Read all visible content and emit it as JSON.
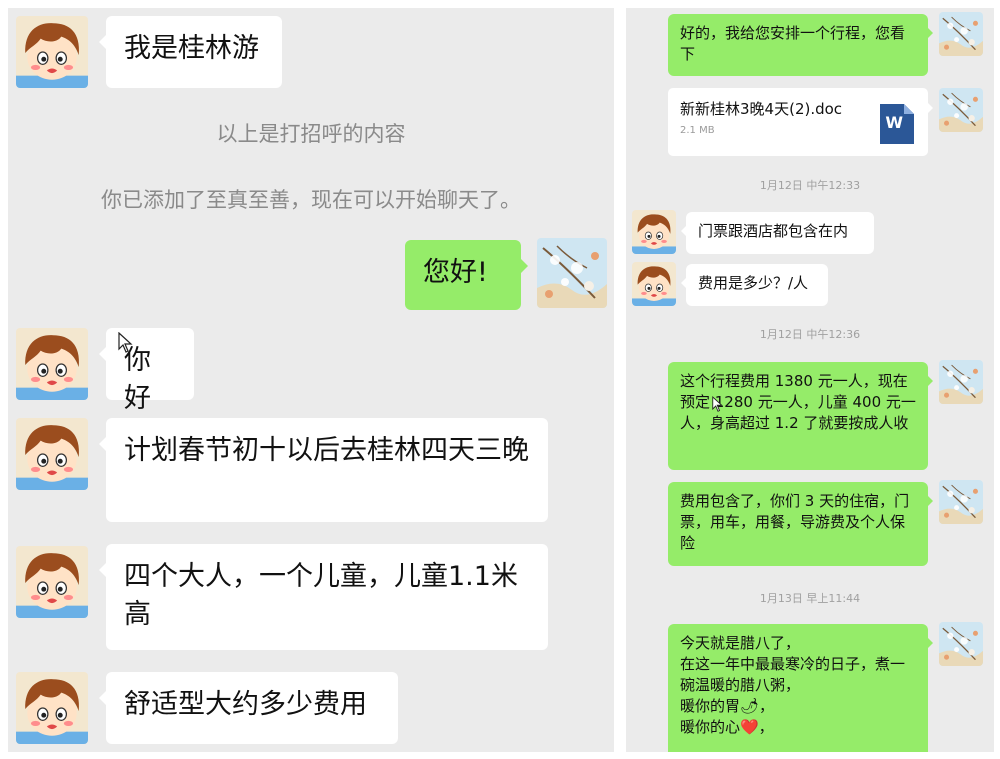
{
  "left": {
    "msg_intro": "我是桂林游",
    "sys_greeting_note": "以上是打招呼的内容",
    "sys_added_note": "你已添加了至真至善，现在可以开始聊天了。",
    "msg_hello_out": "您好!",
    "msg_hello_in": "你好",
    "msg_plan": "计划春节初十以后去桂林四天三晚",
    "msg_people": "四个大人，一个儿童，儿童1.1米高",
    "msg_cost_question": "舒适型大约多少费用"
  },
  "right": {
    "msg_itinerary": "好的，我给您安排一个行程，您看下",
    "doc": {
      "name": "新新桂林3晚4天(2).doc",
      "size": "2.1 MB",
      "icon": "W"
    },
    "time_1": "1月12日 中午12:33",
    "msg_tickets_hotel": "门票跟酒店都包含在内",
    "msg_price_q": "费用是多少？/人",
    "time_2": "1月12日 中午12:36",
    "msg_price_detail": "这个行程费用 1380 元一人，现在预定 1280 元一人，儿童 400 元一人，身高超过 1.2 了就要按成人收",
    "msg_includes": "费用包含了，你们 3 天的住宿，门票，用车，用餐，导游费及个人保险",
    "time_3": "1月13日 早上11:44",
    "msg_laba": "今天就是腊八了，\n在这一年中最最寒冷的日子，煮一碗温暖的腊八粥，\n暖你的胃🌶，\n暖你的心❤️，"
  },
  "colors": {
    "background": "#ebebeb",
    "incoming_bubble": "#ffffff",
    "outgoing_bubble": "#95ec69",
    "word_icon": "#2b5797"
  }
}
